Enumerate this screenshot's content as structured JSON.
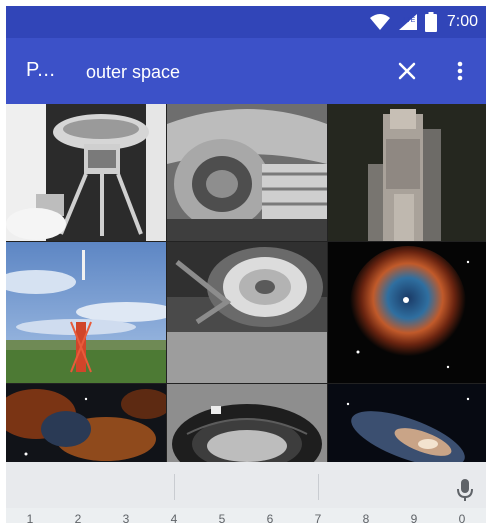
{
  "statusbar": {
    "time": "7:00",
    "icons": [
      "wifi-icon",
      "lte-signal-icon",
      "battery-icon"
    ]
  },
  "appbar": {
    "title": "P...",
    "search_query": "outer space",
    "close_icon": "close-icon",
    "more_icon": "more-vert-icon"
  },
  "grid": {
    "tiles": [
      {
        "subject": "space probe"
      },
      {
        "subject": "machinery close-up"
      },
      {
        "subject": "rocket on pad"
      },
      {
        "subject": "rocket launch"
      },
      {
        "subject": "wheel"
      },
      {
        "subject": "nebula"
      },
      {
        "subject": "nebula"
      },
      {
        "subject": "coil"
      },
      {
        "subject": "galaxy"
      }
    ]
  },
  "keyboard": {
    "mic_icon": "microphone-icon",
    "digits": [
      "1",
      "2",
      "3",
      "4",
      "5",
      "6",
      "7",
      "8",
      "9",
      "0"
    ]
  },
  "colors": {
    "status_bar": "#3145b8",
    "app_bar": "#3c51c8",
    "keyboard_bg": "#e8eaed"
  }
}
